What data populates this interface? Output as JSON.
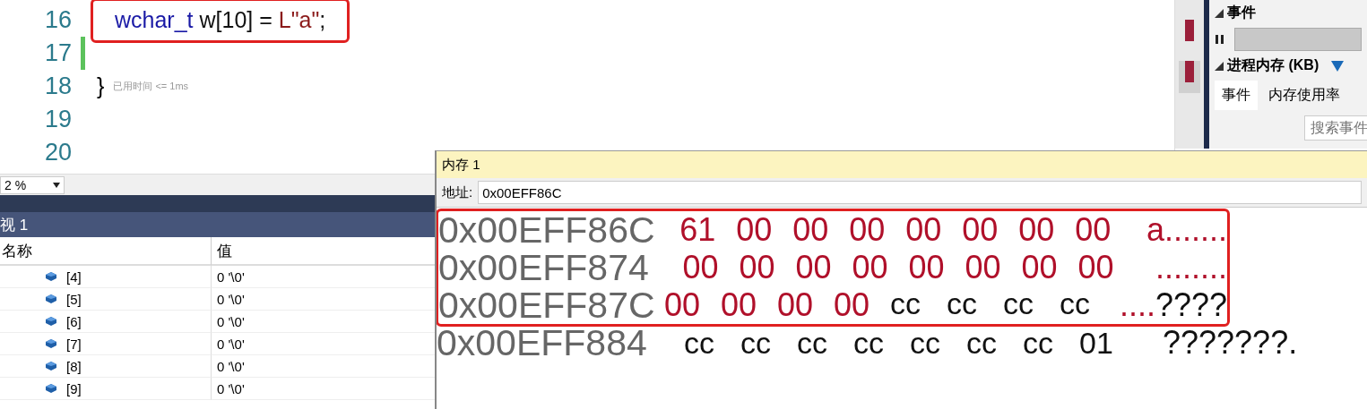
{
  "editor": {
    "lines": [
      {
        "number": "16",
        "kind": "code",
        "highlighted": true,
        "tokens": [
          {
            "text": "wchar_t",
            "kind": "keyword"
          },
          {
            "text": " w[10] = ",
            "kind": "plain"
          },
          {
            "text": "L\"a\"",
            "kind": "string"
          },
          {
            "text": ";",
            "kind": "plain"
          }
        ]
      },
      {
        "number": "17",
        "kind": "blank",
        "changed": true
      },
      {
        "number": "18",
        "kind": "brace",
        "text": "}",
        "hint": "已用时间 <= 1ms"
      },
      {
        "number": "19",
        "kind": "blank",
        "changed": false
      },
      {
        "number": "20",
        "kind": "blank",
        "changed": false
      }
    ],
    "zoom": "2 %"
  },
  "diagnostics": {
    "events_section": "事件",
    "memory_section": "进程内存 (KB)",
    "tabs": [
      {
        "label": "事件",
        "selected": true
      },
      {
        "label": "内存使用率",
        "selected": false
      }
    ],
    "search": {
      "placeholder": "搜索事件"
    }
  },
  "watch": {
    "title": "视 1",
    "columns": [
      "名称",
      "值"
    ],
    "rows": [
      {
        "name": "[4]",
        "value": "0 '\\0'"
      },
      {
        "name": "[5]",
        "value": "0 '\\0'"
      },
      {
        "name": "[6]",
        "value": "0 '\\0'"
      },
      {
        "name": "[7]",
        "value": "0 '\\0'"
      },
      {
        "name": "[8]",
        "value": "0 '\\0'"
      },
      {
        "name": "[9]",
        "value": "0 '\\0'"
      }
    ]
  },
  "memory": {
    "title": "内存 1",
    "address_label": "地址:",
    "address": "0x00EFF86C",
    "rows": [
      {
        "address": "0x00EFF86C",
        "highlighted": true,
        "bytes": [
          {
            "text": "61",
            "changed": true
          },
          {
            "text": "00",
            "changed": true
          },
          {
            "text": "00",
            "changed": true
          },
          {
            "text": "00",
            "changed": true
          },
          {
            "text": "00",
            "changed": true
          },
          {
            "text": "00",
            "changed": true
          },
          {
            "text": "00",
            "changed": true
          },
          {
            "text": "00",
            "changed": true
          }
        ],
        "ascii": [
          {
            "text": "a.......",
            "changed": true
          }
        ]
      },
      {
        "address": "0x00EFF874",
        "highlighted": true,
        "bytes": [
          {
            "text": "00",
            "changed": true
          },
          {
            "text": "00",
            "changed": true
          },
          {
            "text": "00",
            "changed": true
          },
          {
            "text": "00",
            "changed": true
          },
          {
            "text": "00",
            "changed": true
          },
          {
            "text": "00",
            "changed": true
          },
          {
            "text": "00",
            "changed": true
          },
          {
            "text": "00",
            "changed": true
          }
        ],
        "ascii": [
          {
            "text": "........",
            "changed": true
          }
        ]
      },
      {
        "address": "0x00EFF87C",
        "highlighted": true,
        "bytes": [
          {
            "text": "00",
            "changed": true
          },
          {
            "text": "00",
            "changed": true
          },
          {
            "text": "00",
            "changed": true
          },
          {
            "text": "00",
            "changed": true
          },
          {
            "text": "cc",
            "changed": false
          },
          {
            "text": "cc",
            "changed": false
          },
          {
            "text": "cc",
            "changed": false
          },
          {
            "text": "cc",
            "changed": false
          }
        ],
        "ascii": [
          {
            "text": "....",
            "changed": true
          },
          {
            "text": "????",
            "changed": false
          }
        ]
      },
      {
        "address": "0x00EFF884",
        "highlighted": false,
        "bytes": [
          {
            "text": "cc",
            "changed": false
          },
          {
            "text": "cc",
            "changed": false
          },
          {
            "text": "cc",
            "changed": false
          },
          {
            "text": "cc",
            "changed": false
          },
          {
            "text": "cc",
            "changed": false
          },
          {
            "text": "cc",
            "changed": false
          },
          {
            "text": "cc",
            "changed": false
          },
          {
            "text": "01",
            "changed": false
          }
        ],
        "ascii": [
          {
            "text": "???????.",
            "changed": false
          }
        ]
      }
    ]
  }
}
